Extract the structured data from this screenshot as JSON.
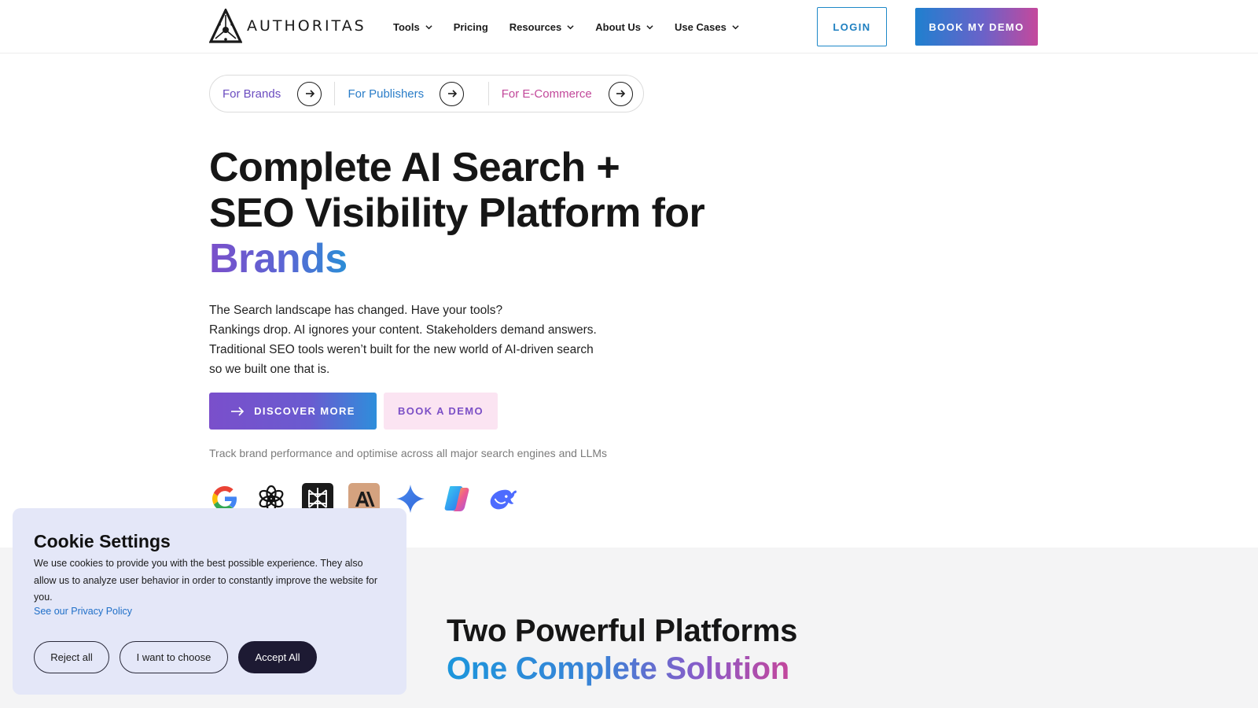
{
  "header": {
    "logo_text": "AUTHORITAS",
    "nav": [
      {
        "label": "Tools",
        "has_dropdown": true
      },
      {
        "label": "Pricing",
        "has_dropdown": false
      },
      {
        "label": "Resources",
        "has_dropdown": true
      },
      {
        "label": "About Us",
        "has_dropdown": true
      },
      {
        "label": "Use Cases",
        "has_dropdown": true
      }
    ],
    "login_label": "LOGIN",
    "demo_label": "BOOK MY DEMO"
  },
  "audience": [
    {
      "label": "For Brands",
      "color": "#6b4cc0"
    },
    {
      "label": "For Publishers",
      "color": "#2a7dc8"
    },
    {
      "label": "For E-Commerce",
      "color": "#c2489a"
    }
  ],
  "hero": {
    "title_line1": "Complete AI Search +",
    "title_line2": "SEO Visibility Platform for",
    "title_accent": "Brands",
    "paragraph": [
      "The Search landscape has changed. Have your tools?",
      "Rankings drop. AI ignores your content. Stakeholders demand answers.",
      "Traditional SEO tools weren’t built for the new world of AI-driven search",
      "so we built one that is."
    ],
    "discover_label": "DISCOVER MORE",
    "book_label": "BOOK A DEMO",
    "track_text": "Track brand performance and optimise across all major search engines and LLMs",
    "engines": [
      "google-logo",
      "chatgpt-logo",
      "perplexity-logo",
      "anthropic-logo",
      "gemini-logo",
      "copilot-logo",
      "deepseek-logo"
    ]
  },
  "platforms": {
    "title": "Two Powerful Platforms",
    "subtitle": "One Complete Solution"
  },
  "cookie": {
    "title": "Cookie Settings",
    "text": "We use cookies to provide you with the best possible experience. They also allow us to analyze user behavior in order to constantly improve the website for you.",
    "link": "See our Privacy Policy",
    "reject_label": "Reject all",
    "choose_label": "I want to choose",
    "accept_label": "Accept All"
  },
  "colors": {
    "brand_blue": "#1e7fc0",
    "brand_purple": "#7a4fcb",
    "brand_pink": "#c5489c",
    "cookie_bg": "#e4e7f8",
    "accept_bg": "#1d1a33"
  }
}
